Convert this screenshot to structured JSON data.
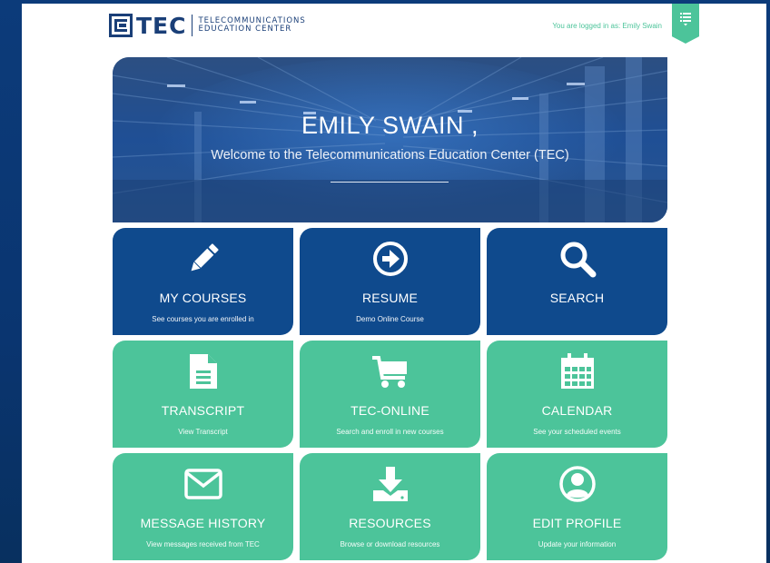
{
  "header": {
    "logo_text": "TEC",
    "logo_line1": "TELECOMMUNICATIONS",
    "logo_line2": "EDUCATION CENTER",
    "login_status": "You are logged in as: Emily Swain"
  },
  "hero": {
    "name": "EMILY SWAIN ,",
    "welcome": "Welcome to the Telecommunications Education Center (TEC)"
  },
  "colors": {
    "primary_blue": "#0f4a8d",
    "accent_green": "#4cc49a",
    "page_bg": "#0c3b7a"
  },
  "tiles": [
    {
      "title": "MY COURSES",
      "subtitle": "See courses you are enrolled in",
      "icon": "pencil-icon",
      "color": "blue"
    },
    {
      "title": "RESUME",
      "subtitle": "Demo Online Course",
      "icon": "arrow-circle-right-icon",
      "color": "blue"
    },
    {
      "title": "SEARCH",
      "subtitle": "",
      "icon": "search-icon",
      "color": "blue"
    },
    {
      "title": "TRANSCRIPT",
      "subtitle": "View Transcript",
      "icon": "document-icon",
      "color": "green"
    },
    {
      "title": "TEC-ONLINE",
      "subtitle": "Search and enroll in new courses",
      "icon": "cart-icon",
      "color": "green"
    },
    {
      "title": "CALENDAR",
      "subtitle": "See your scheduled events",
      "icon": "calendar-icon",
      "color": "green"
    },
    {
      "title": "MESSAGE HISTORY",
      "subtitle": "View messages received from TEC",
      "icon": "envelope-icon",
      "color": "green"
    },
    {
      "title": "RESOURCES",
      "subtitle": "Browse or download resources",
      "icon": "download-icon",
      "color": "green"
    },
    {
      "title": "EDIT PROFILE",
      "subtitle": "Update your information",
      "icon": "user-circle-icon",
      "color": "green"
    }
  ]
}
